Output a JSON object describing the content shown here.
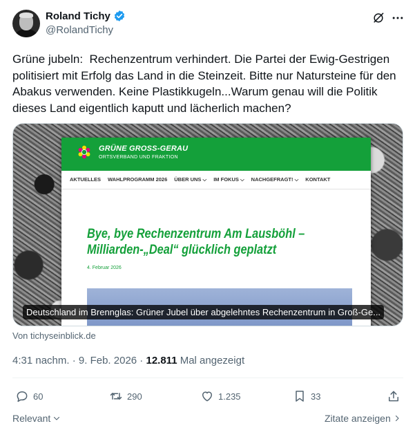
{
  "author": {
    "display_name": "Roland Tichy",
    "handle": "@RolandTichy"
  },
  "tweet": {
    "text": "Grüne jubeln:  Rechenzentrum verhindert. Die Partei der Ewig-Gestrigen politisiert mit Erfolg das Land in die Steinzeit. Bitte nur Natursteine für den Abakus verwenden. Keine Plastikkugeln...Warum genau will die Politik dieses Land eigentlich kaputt und lächerlich machen?"
  },
  "card": {
    "site": {
      "title": "GRÜNE GROSS-GERAU",
      "subtitle": "ORTSVERBAND UND FRAKTION",
      "nav": [
        "AKTUELLES",
        "WAHLPROGRAMM 2026",
        "ÜBER UNS",
        "IM FOKUS",
        "NACHGEFRAGT!",
        "KONTAKT"
      ],
      "headline": "Bye, bye Rechenzentrum Am Lausböhl – Milliarden-„Deal“ glücklich geplatzt",
      "date": "4. Februar 2026"
    },
    "caption": "Deutschland im Brennglas: Grüner Jubel über abgelehntes Rechenzentrum in Groß-Ge...",
    "source": "Von tichyseinblick.de"
  },
  "meta": {
    "time": "4:31 nachm.",
    "separator": " · ",
    "date": "9. Feb. 2026",
    "views_count": "12.811",
    "views_label": " Mal angezeigt"
  },
  "actions": {
    "replies": "60",
    "reposts": "290",
    "likes": "1.235",
    "bookmarks": "33"
  },
  "bottom": {
    "relevant": "Relevant",
    "quotes": "Zitate anzeigen"
  },
  "colors": {
    "verified_blue": "#1d9bf0",
    "green_site": "#14a03a",
    "text_secondary": "#536471"
  }
}
